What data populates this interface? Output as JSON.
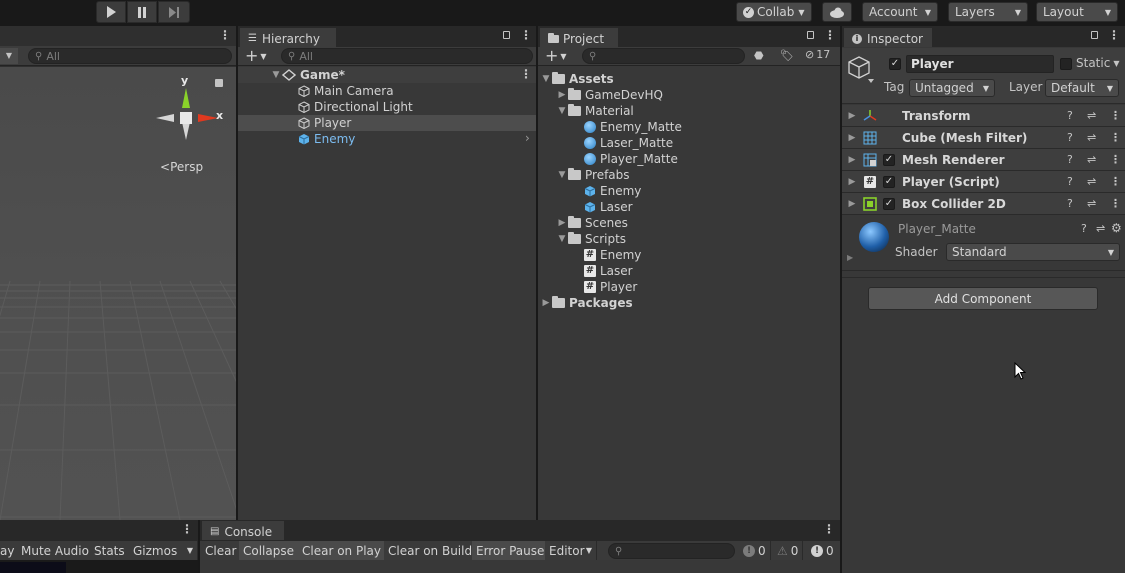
{
  "toolbar": {
    "collab": "Collab",
    "account": "Account",
    "layers": "Layers",
    "layout": "Layout"
  },
  "scene": {
    "search_placeholder": "All",
    "persp": "Persp",
    "axis_y": "y",
    "axis_x": "x"
  },
  "hierarchy": {
    "tab": "Hierarchy",
    "search_placeholder": "All",
    "scene_name": "Game*",
    "items": [
      "Main Camera",
      "Directional Light",
      "Player",
      "Enemy"
    ]
  },
  "project": {
    "tab": "Project",
    "hidden_count": "17",
    "assets": "Assets",
    "gamedevhq": "GameDevHQ",
    "material": "Material",
    "materials": [
      "Enemy_Matte",
      "Laser_Matte",
      "Player_Matte"
    ],
    "prefabs": "Prefabs",
    "prefab_items": [
      "Enemy",
      "Laser"
    ],
    "scenes": "Scenes",
    "scripts": "Scripts",
    "script_items": [
      "Enemy",
      "Laser",
      "Player"
    ],
    "packages": "Packages"
  },
  "inspector": {
    "tab": "Inspector",
    "object_name": "Player",
    "static_label": "Static",
    "tag_label": "Tag",
    "tag_value": "Untagged",
    "layer_label": "Layer",
    "layer_value": "Default",
    "components": [
      "Transform",
      "Cube (Mesh Filter)",
      "Mesh Renderer",
      "Player (Script)",
      "Box Collider 2D"
    ],
    "material_name": "Player_Matte",
    "shader_label": "Shader",
    "shader_value": "Standard",
    "add_component": "Add Component"
  },
  "game_bar": {
    "cut_label": "ay",
    "mute_audio": "Mute Audio",
    "stats": "Stats",
    "gizmos": "Gizmos"
  },
  "console": {
    "tab": "Console",
    "clear": "Clear",
    "collapse": "Collapse",
    "clear_on_play": "Clear on Play",
    "clear_on_build": "Clear on Build",
    "error_pause": "Error Pause",
    "editor": "Editor",
    "log_count": "0",
    "warn_count": "0",
    "error_count": "0"
  }
}
